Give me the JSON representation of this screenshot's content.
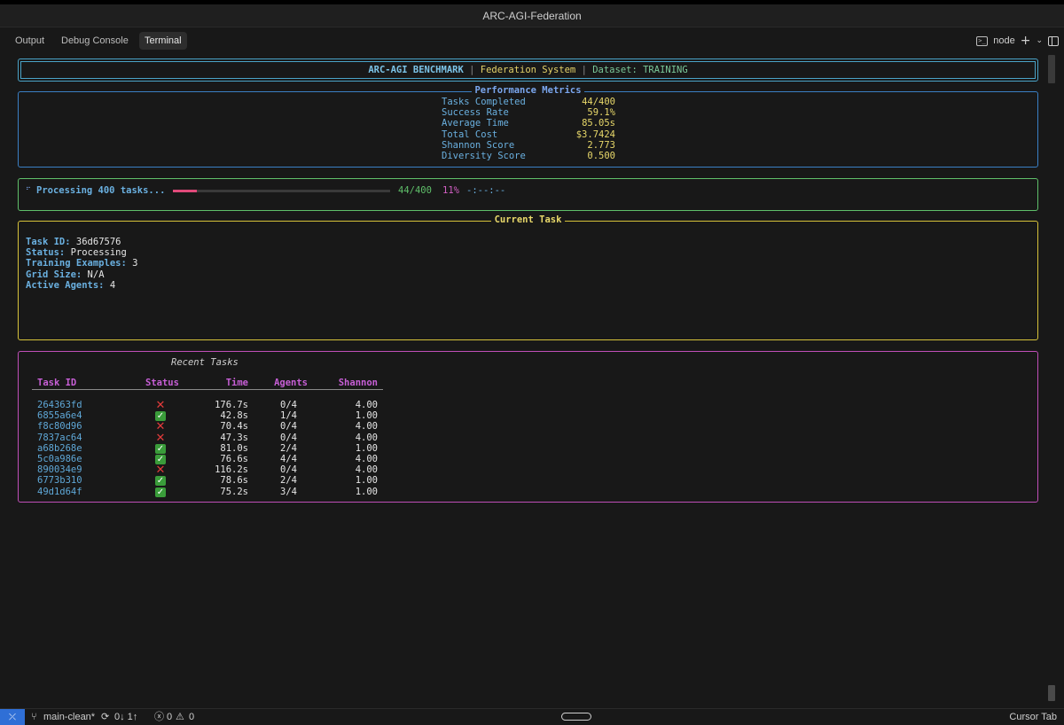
{
  "window": {
    "title": "ARC-AGI-Federation"
  },
  "panel": {
    "tabs": [
      {
        "label": "Output"
      },
      {
        "label": "Debug Console"
      },
      {
        "label": "Terminal"
      }
    ],
    "active_tab": "Terminal",
    "shell_label": "node"
  },
  "terminal": {
    "header": {
      "name": "ARC-AGI BENCHMARK",
      "separator": "|",
      "system": "Federation System",
      "dataset": "Dataset: TRAINING"
    },
    "metrics": {
      "title": "Performance Metrics",
      "rows": [
        {
          "label": "Tasks Completed",
          "value": "44/400"
        },
        {
          "label": "Success Rate",
          "value": "59.1%"
        },
        {
          "label": "Average Time",
          "value": "85.05s"
        },
        {
          "label": "Total Cost",
          "value": "$3.7424"
        },
        {
          "label": "Shannon Score",
          "value": "2.773"
        },
        {
          "label": "Diversity Score",
          "value": "0.500"
        }
      ]
    },
    "progress": {
      "spinner": "⠋",
      "label": "Processing 400 tasks...",
      "fraction": 0.11,
      "count": "44/400",
      "percent": "11%",
      "eta": "-:--:--"
    },
    "current_task": {
      "title": "Current Task",
      "fields": [
        {
          "key": "Task ID:",
          "value": "36d67576"
        },
        {
          "key": "Status:",
          "value": "Processing"
        },
        {
          "key": "Training Examples:",
          "value": "3"
        },
        {
          "key": "Grid Size:",
          "value": "N/A"
        },
        {
          "key": "Active Agents:",
          "value": "4"
        }
      ]
    },
    "recent_tasks": {
      "caption": "Recent Tasks",
      "columns": [
        "Task ID",
        "Status",
        "Time",
        "Agents",
        "Shannon"
      ],
      "rows": [
        {
          "id": "264363fd",
          "status": "fail",
          "time": "176.7s",
          "agents": "0/4",
          "shannon": "4.00"
        },
        {
          "id": "6855a6e4",
          "status": "ok",
          "time": "42.8s",
          "agents": "1/4",
          "shannon": "1.00"
        },
        {
          "id": "f8c80d96",
          "status": "fail",
          "time": "70.4s",
          "agents": "0/4",
          "shannon": "4.00"
        },
        {
          "id": "7837ac64",
          "status": "fail",
          "time": "47.3s",
          "agents": "0/4",
          "shannon": "4.00"
        },
        {
          "id": "a68b268e",
          "status": "ok",
          "time": "81.0s",
          "agents": "2/4",
          "shannon": "1.00"
        },
        {
          "id": "5c0a986e",
          "status": "ok",
          "time": "76.6s",
          "agents": "4/4",
          "shannon": "4.00"
        },
        {
          "id": "890034e9",
          "status": "fail",
          "time": "116.2s",
          "agents": "0/4",
          "shannon": "4.00"
        },
        {
          "id": "6773b310",
          "status": "ok",
          "time": "78.6s",
          "agents": "2/4",
          "shannon": "1.00"
        },
        {
          "id": "49d1d64f",
          "status": "ok",
          "time": "75.2s",
          "agents": "3/4",
          "shannon": "1.00"
        }
      ]
    }
  },
  "statusbar": {
    "branch": "main-clean*",
    "sync": "0↓ 1↑",
    "errors": "0",
    "warnings": "0",
    "right_label": "Cursor Tab"
  },
  "icons": {
    "remote": "remote-icon",
    "branch": "git-branch-icon",
    "sync": "sync-icon",
    "error": "error-icon",
    "warning": "warning-icon",
    "terminal": "terminal-icon",
    "add": "plus-icon",
    "dropdown": "chevron-down-icon",
    "split": "split-panel-icon",
    "ok": "check-icon",
    "fail": "cross-icon"
  },
  "colors": {
    "header_border": "#4aa3c7",
    "metrics_border": "#3a7fc4",
    "progress_border": "#5fbf6a",
    "current_border": "#d6c23a",
    "recent_border": "#c04fb8",
    "progress_fill": "#e04a7a",
    "status_ok": "#3a9c3a",
    "status_fail": "#e23b3b",
    "remote_badge": "#2f6fd6"
  }
}
